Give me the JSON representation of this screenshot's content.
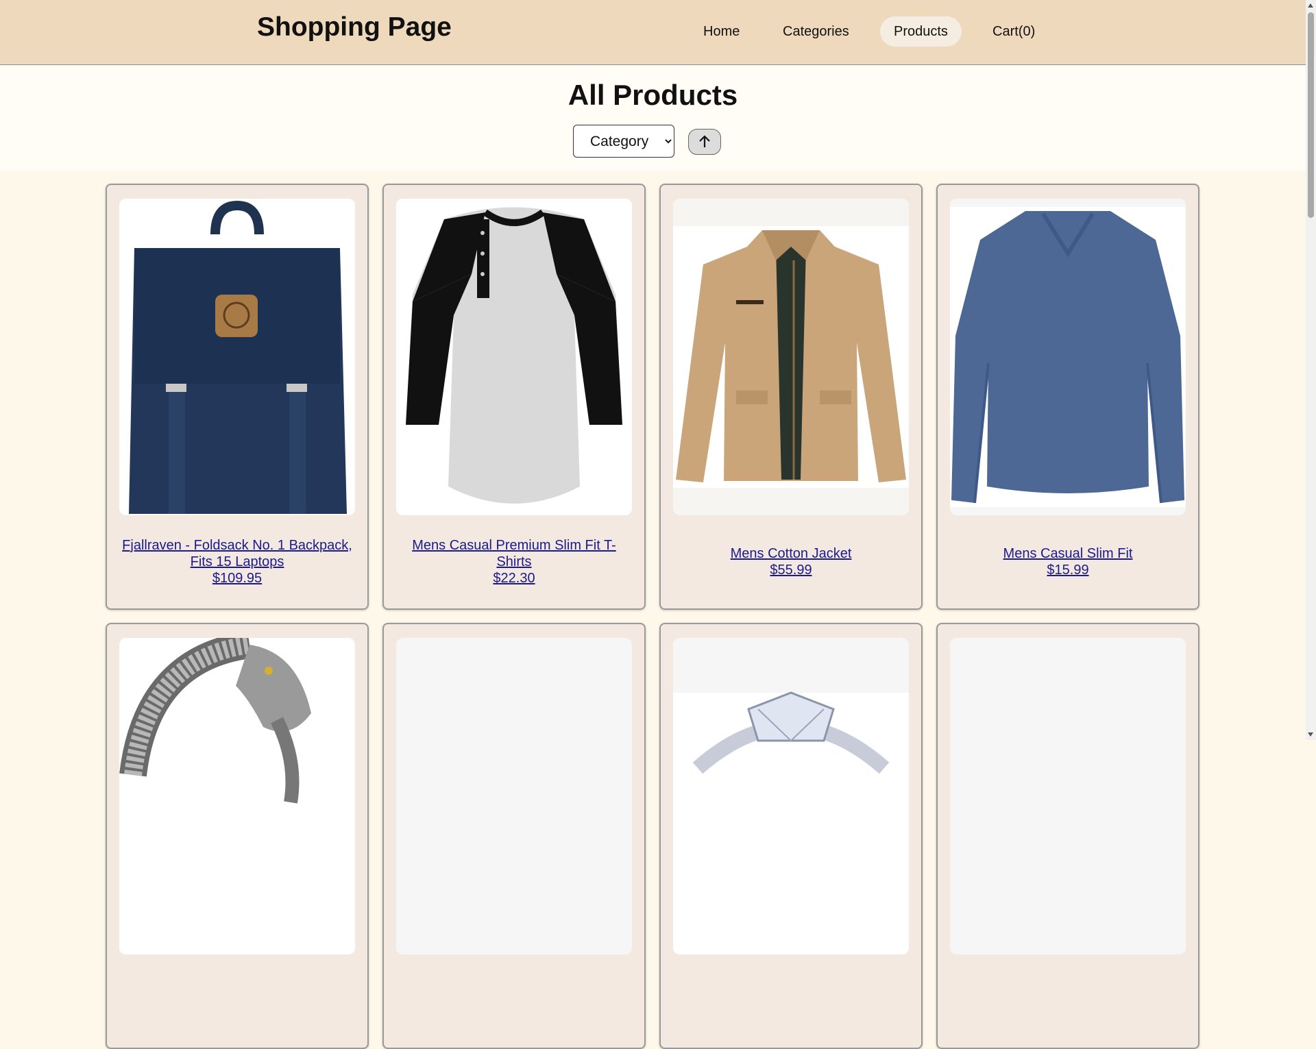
{
  "header": {
    "site_title": "Shopping Page",
    "nav": [
      {
        "label": "Home"
      },
      {
        "label": "Categories"
      },
      {
        "label": "Products",
        "active": true
      },
      {
        "label": "Cart(0)"
      }
    ]
  },
  "main": {
    "title": "All Products",
    "category_select": {
      "selected": "Category"
    },
    "sort_icon": "arrow-up-icon"
  },
  "products": [
    {
      "name": "Fjallraven - Foldsack No. 1 Backpack, Fits 15 Laptops",
      "price": "$109.95",
      "image": "backpack"
    },
    {
      "name": "Mens Casual Premium Slim Fit T-Shirts",
      "price": "$22.30",
      "image": "raglan-tshirt"
    },
    {
      "name": "Mens Cotton Jacket",
      "price": "$55.99",
      "image": "jacket"
    },
    {
      "name": "Mens Casual Slim Fit",
      "price": "$15.99",
      "image": "long-sleeve-shirt"
    },
    {
      "image": "dragon-bracelet"
    },
    {
      "image": "blank"
    },
    {
      "image": "diamond-ring"
    },
    {
      "image": "blank"
    }
  ],
  "colors": {
    "header_bg": "#efd9bd",
    "page_bg": "#fdf8ea",
    "card_bg": "#f4e9e0",
    "link": "#1a1a8c"
  }
}
